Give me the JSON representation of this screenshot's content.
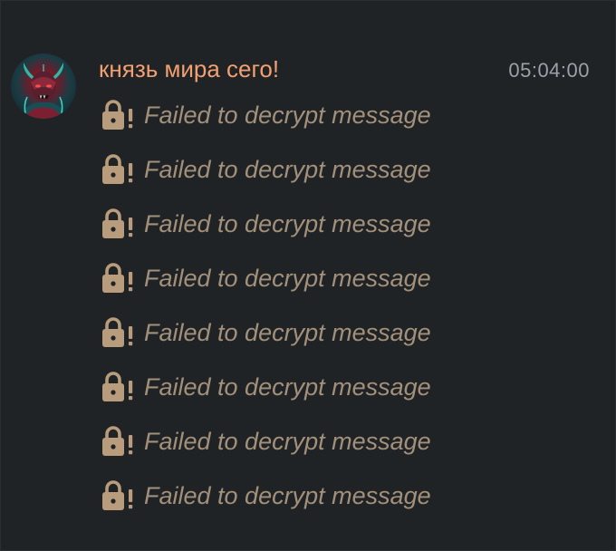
{
  "header": {
    "sender_name": "князь мира сего!",
    "timestamp": "05:04:00"
  },
  "avatar": {
    "icon": "demon-avatar-icon"
  },
  "messages": [
    {
      "icon": "locked-warning-icon",
      "text": "Failed to decrypt message"
    },
    {
      "icon": "locked-warning-icon",
      "text": "Failed to decrypt message"
    },
    {
      "icon": "locked-warning-icon",
      "text": "Failed to decrypt message"
    },
    {
      "icon": "locked-warning-icon",
      "text": "Failed to decrypt message"
    },
    {
      "icon": "locked-warning-icon",
      "text": "Failed to decrypt message"
    },
    {
      "icon": "locked-warning-icon",
      "text": "Failed to decrypt message"
    },
    {
      "icon": "locked-warning-icon",
      "text": "Failed to decrypt message"
    },
    {
      "icon": "locked-warning-icon",
      "text": "Failed to decrypt message"
    }
  ],
  "colors": {
    "background": "#202326",
    "sender": "#f2a071",
    "timestamp": "#9aa1a8",
    "error_text": "#a2907a",
    "lock": "#b89c7b"
  }
}
